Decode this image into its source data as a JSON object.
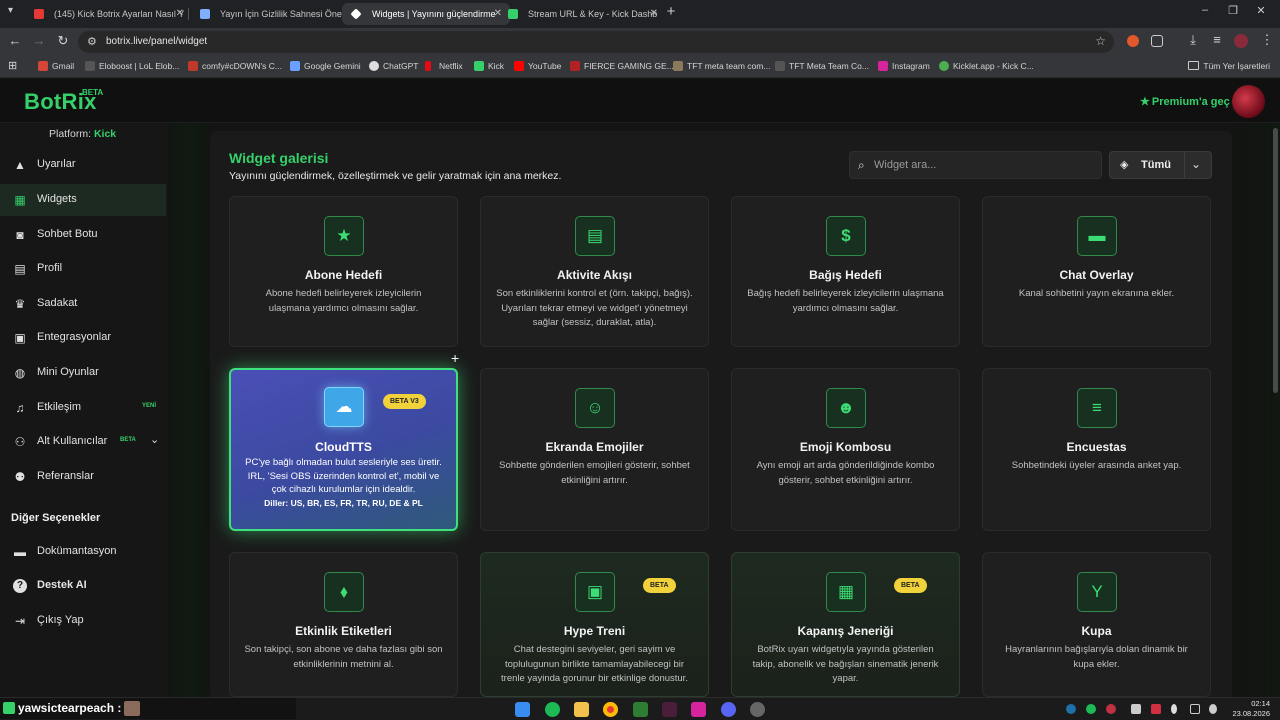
{
  "browser": {
    "tabs": [
      {
        "title": "(145) Kick Botrix Ayarları Nasıl Y",
        "favicon_color": "#e53935"
      },
      {
        "title": "Yayın İçin Gizlilik Sahnesi Öneri",
        "favicon_color": "#7fb0ff"
      },
      {
        "title": "Widgets | Yayınını güçlendirme",
        "favicon_color": "#ffffff"
      },
      {
        "title": "Stream URL & Key - Kick Dashb",
        "favicon_color": "#35d06a"
      }
    ],
    "url": "botrix.live/panel/widget",
    "bookmarks": [
      {
        "label": "Gmail",
        "color": "#d44638"
      },
      {
        "label": "Eloboost | LoL Elob...",
        "color": "#555555"
      },
      {
        "label": "comfy#cDOWN's C...",
        "color": "#c0392b"
      },
      {
        "label": "Google Gemini",
        "color": "#6aa0ff"
      },
      {
        "label": "ChatGPT",
        "color": "#dddddd"
      },
      {
        "label": "Netflix",
        "color": "#e50914"
      },
      {
        "label": "Kick",
        "color": "#35d06a"
      },
      {
        "label": "YouTube",
        "color": "#ff0000"
      },
      {
        "label": "FIERCE GAMING GE...",
        "color": "#b22222"
      },
      {
        "label": "TFT meta team com...",
        "color": "#8a7a5a"
      },
      {
        "label": "TFT Meta Team Co...",
        "color": "#555555"
      },
      {
        "label": "Instagram",
        "color": "#d6249f"
      },
      {
        "label": "Kicklet.app - Kick C...",
        "color": "#4caf50"
      }
    ],
    "all_bookmarks": "Tüm Yer İşaretleri"
  },
  "header": {
    "logo": "BotRix",
    "logo_badge": "BETA",
    "premium": "Premium'a geç"
  },
  "sidebar": {
    "platform_label": "Platform:",
    "platform_value": "Kick",
    "items": [
      {
        "label": "Uyarılar",
        "icon": "warning-icon"
      },
      {
        "label": "Widgets",
        "icon": "grid-icon"
      },
      {
        "label": "Sohbet Botu",
        "icon": "robot-icon"
      },
      {
        "label": "Profil",
        "icon": "id-card-icon"
      },
      {
        "label": "Sadakat",
        "icon": "trophy-icon"
      },
      {
        "label": "Entegrasyonlar",
        "icon": "plug-icon"
      },
      {
        "label": "Mini Oyunlar",
        "icon": "gamepad-icon"
      },
      {
        "label": "Etkileşim",
        "icon": "music-icon",
        "tag": "YENİ"
      },
      {
        "label": "Alt Kullanıcılar",
        "icon": "users-icon",
        "tag": "BETA"
      },
      {
        "label": "Referanslar",
        "icon": "user-friends-icon"
      }
    ],
    "other_title": "Diğer Seçenekler",
    "other_items": [
      {
        "label": "Dokümantasyon",
        "icon": "book-icon"
      },
      {
        "label": "Destek AI",
        "icon": "question-icon"
      },
      {
        "label": "Çıkış Yap",
        "icon": "logout-icon"
      }
    ]
  },
  "gallery": {
    "title": "Widget galerisi",
    "subtitle": "Yayınını güçlendirmek, özelleştirmek ve gelir yaratmak için ana merkez.",
    "search_placeholder": "Widget ara...",
    "filter_label": "Tümü",
    "cards": [
      {
        "title": "Abone Hedefi",
        "desc": "Abone hedefi belirleyerek izleyicilerin ulaşmana yardımcı olmasını sağlar.",
        "icon": "★"
      },
      {
        "title": "Aktivite Akışı",
        "desc": "Son etkinliklerini kontrol et (örn. takipçi, bağış). Uyarıları tekrar etmeyi ve widget'ı yönetmeyi sağlar (sessiz, duraklat, atla).",
        "icon": "▤"
      },
      {
        "title": "Bağış Hedefi",
        "desc": "Bağış hedefi belirleyerek izleyicilerin ulaşmana yardımcı olmasını sağlar.",
        "icon": "$"
      },
      {
        "title": "Chat Overlay",
        "desc": "Kanal sohbetini yayın ekranına ekler.",
        "icon": "▬"
      },
      {
        "title": "CloudTTS",
        "desc": "PC'ye bağlı olmadan bulut sesleriyle ses üretir. IRL, 'Sesi OBS üzerinden kontrol et', mobil ve çok cihazlı kurulumlar için idealdir.",
        "desc2": "Diller: US, BR, ES, FR, TR, RU, DE & PL",
        "icon": "☁",
        "badge": "BETA V3"
      },
      {
        "title": "Ekranda Emojiler",
        "desc": "Sohbette gönderilen emojileri gösterir, sohbet etkinliğini artırır.",
        "icon": "☺"
      },
      {
        "title": "Emoji Kombosu",
        "desc": "Aynı emoji art arda gönderildiğinde kombo gösterir, sohbet etkinliğini artırır.",
        "icon": "☻"
      },
      {
        "title": "Encuestas",
        "desc": "Sohbetindeki üyeler arasında anket yap.",
        "icon": "≡"
      },
      {
        "title": "Etkinlik Etiketleri",
        "desc": "Son takipçi, son abone ve daha fazlası gibi son etkinliklerinin metnini al.",
        "icon": "⬧"
      },
      {
        "title": "Hype Treni",
        "desc": "Chat destegini seviyeler, geri sayim ve toplulugunun birlikte tamamlayabilecegi bir trenle yayinda gorunur bir etkinlige donustur.",
        "icon": "▣",
        "badge": "BETA"
      },
      {
        "title": "Kapanış Jeneriği",
        "desc": "BotRix uyarı widgetıyla yayında gösterilen takip, abonelik ve bağışları sinematik jenerik yapar.",
        "icon": "▦",
        "badge": "BETA"
      },
      {
        "title": "Kupa",
        "desc": "Hayranlarının bağışlarıyla dolan dinamik bir kupa ekler.",
        "icon": "Y"
      }
    ]
  },
  "chat": {
    "username": "yawsictearpeach :"
  },
  "clock": {
    "time": "02:14",
    "date": "23.08.2026"
  }
}
